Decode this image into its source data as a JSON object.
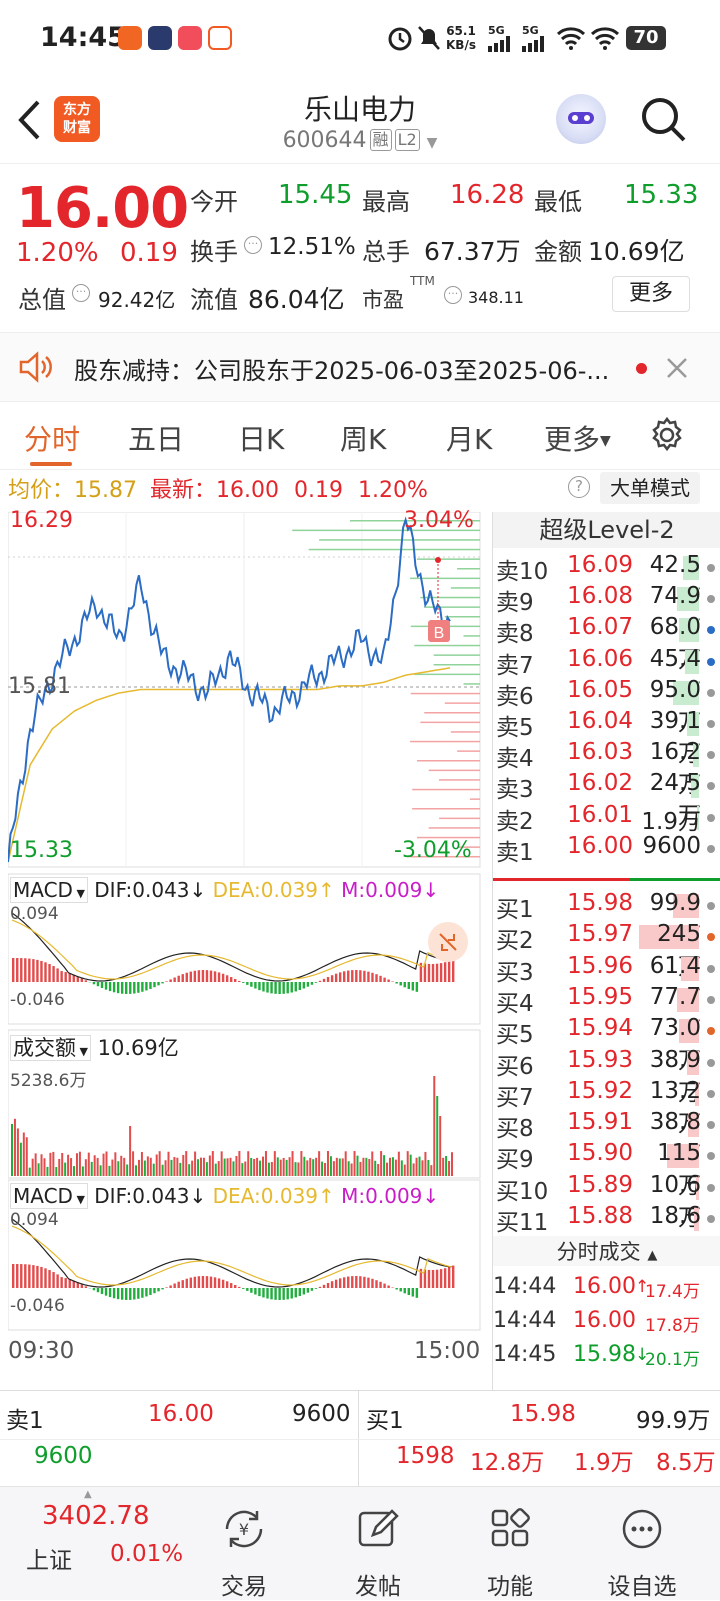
{
  "status_bar": {
    "time": "14:45",
    "net_speed_top": "65.1",
    "net_speed_unit": "KB/s",
    "sig1": "5G",
    "sig2": "5G",
    "battery": "70"
  },
  "header": {
    "logo_text_1": "东方",
    "logo_text_2": "财富",
    "title": "乐山电力",
    "code": "600644",
    "tag1": "融",
    "tag2": "L2"
  },
  "quote": {
    "price": "16.00",
    "change_pct": "1.20%",
    "change": "0.19",
    "open_label": "今开",
    "open": "15.45",
    "high_label": "最高",
    "high": "16.28",
    "low_label": "最低",
    "low": "15.33",
    "turnover_label": "换手",
    "turnover": "12.51%",
    "volume_label": "总手",
    "volume": "67.37万",
    "amount_label": "金额",
    "amount": "10.69亿",
    "mktcap_label": "总值",
    "mktcap": "92.42亿",
    "float_label": "流值",
    "float": "86.04亿",
    "pe_label": "市盈",
    "pe_sup": "TTM",
    "pe": "348.11",
    "more_button": "更多"
  },
  "notice": {
    "text": "股东减持：公司股东于2025-06-03至2025-06-..."
  },
  "tabs": [
    "分时",
    "五日",
    "日K",
    "周K",
    "月K",
    "更多"
  ],
  "infoline": {
    "avg_label": "均价：",
    "avg": "15.87",
    "latest_label": "最新：",
    "latest": "16.00",
    "change": "0.19",
    "pct": "1.20%",
    "mode_button": "大单模式"
  },
  "chart": {
    "y_top": "16.29",
    "y_mid": "15.81",
    "y_bottom": "15.33",
    "pct_top": "3.04%",
    "pct_bottom": "-3.04%",
    "b_marker": "B",
    "macd_label": "MACD",
    "dif": "DIF:0.043",
    "dea": "DEA:0.039",
    "m": "M:0.009",
    "macd_top": "0.094",
    "macd_bottom": "-0.046",
    "vol_label": "成交额",
    "vol_total": "10.69亿",
    "vol_max": "5238.6万",
    "time_start": "09:30",
    "time_end": "15:00"
  },
  "chart_data": {
    "type": "line",
    "title": "",
    "x": [
      "09:30",
      "15:00"
    ],
    "ylim": [
      15.33,
      16.29
    ],
    "series": [
      {
        "name": "",
        "values": [
          15.33,
          15.7,
          15.85,
          15.95,
          16.05,
          15.95,
          16.1,
          15.9,
          15.85,
          15.8,
          15.9,
          15.8,
          15.75,
          15.8,
          15.85,
          15.9,
          15.95,
          15.88,
          16.28,
          16.05,
          16.0
        ]
      },
      {
        "name": "",
        "values": [
          15.33,
          15.6,
          15.7,
          15.75,
          15.78,
          15.8,
          15.81,
          15.81,
          15.81,
          15.81,
          15.81,
          15.81,
          15.81,
          15.81,
          15.81,
          15.82,
          15.82,
          15.83,
          15.85,
          15.86,
          15.87
        ]
      }
    ]
  },
  "book": {
    "header": "超级Level-2",
    "asks": [
      {
        "label": "卖10",
        "price": "16.09",
        "vol": "42.5万"
      },
      {
        "label": "卖9",
        "price": "16.08",
        "vol": "74.9万"
      },
      {
        "label": "卖8",
        "price": "16.07",
        "vol": "68.0万"
      },
      {
        "label": "卖7",
        "price": "16.06",
        "vol": "45.4万"
      },
      {
        "label": "卖6",
        "price": "16.05",
        "vol": "95.0万"
      },
      {
        "label": "卖5",
        "price": "16.04",
        "vol": "39.1万"
      },
      {
        "label": "卖4",
        "price": "16.03",
        "vol": "16.2万"
      },
      {
        "label": "卖3",
        "price": "16.02",
        "vol": "24.5万"
      },
      {
        "label": "卖2",
        "price": "16.01",
        "vol": "1.9万"
      },
      {
        "label": "卖1",
        "price": "16.00",
        "vol": "9600"
      }
    ],
    "bids": [
      {
        "label": "买1",
        "price": "15.98",
        "vol": "99.9万"
      },
      {
        "label": "买2",
        "price": "15.97",
        "vol": "245万"
      },
      {
        "label": "买3",
        "price": "15.96",
        "vol": "61.4万"
      },
      {
        "label": "买4",
        "price": "15.95",
        "vol": "77.7万"
      },
      {
        "label": "买5",
        "price": "15.94",
        "vol": "73.0万"
      },
      {
        "label": "买6",
        "price": "15.93",
        "vol": "38.9万"
      },
      {
        "label": "买7",
        "price": "15.92",
        "vol": "13.2万"
      },
      {
        "label": "买8",
        "price": "15.91",
        "vol": "38.8万"
      },
      {
        "label": "买9",
        "price": "15.90",
        "vol": "115万"
      },
      {
        "label": "买10",
        "price": "15.89",
        "vol": "10.6万"
      },
      {
        "label": "买11",
        "price": "15.88",
        "vol": "18.6万"
      }
    ],
    "ticks_header": "分时成交",
    "ticks": [
      {
        "time": "14:44",
        "price": "16.00",
        "vol": "17.4万",
        "dir": "↑"
      },
      {
        "time": "14:44",
        "price": "16.00",
        "vol": "17.8万",
        "dir": ""
      },
      {
        "time": "14:45",
        "price": "15.98",
        "vol": "20.1万",
        "dir": "↓"
      }
    ]
  },
  "ticker": {
    "sell1_label": "卖1",
    "sell1_price": "16.00",
    "sell1_vol": "9600",
    "buy1_label": "买1",
    "buy1_price": "15.98",
    "buy1_vol": "99.9万",
    "row2_left": "9600",
    "row2_a": "1598",
    "row2_b": "12.8万",
    "row2_c": "1.9万",
    "row2_d": "8.5万"
  },
  "nav": {
    "index_value": "3402.78",
    "index_name": "上证",
    "index_pct": "0.01%",
    "trade": "交易",
    "post": "发帖",
    "func": "功能",
    "watch": "设自选"
  }
}
